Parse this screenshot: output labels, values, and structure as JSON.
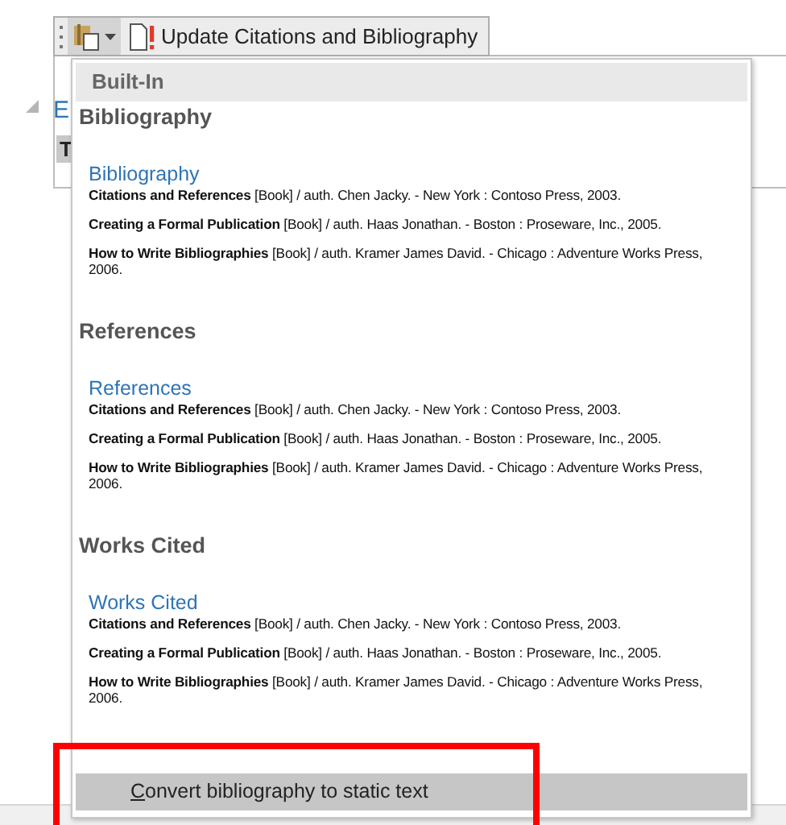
{
  "toolbar": {
    "update_button": "Update Citations and Bibliography"
  },
  "document": {
    "heading_fragment": "E",
    "text_fragment": "T"
  },
  "menu": {
    "header": "Built-In",
    "sections": [
      {
        "heading": "Bibliography",
        "preview_title": "Bibliography",
        "entries": [
          "**Citations and References** [Book] / auth. Chen Jacky. - New York : Contoso Press, 2003.",
          "**Creating a Formal Publication** [Book] / auth. Haas Jonathan. - Boston : Proseware, Inc., 2005.",
          "**How to Write Bibliographies** [Book] / auth. Kramer James David. - Chicago : Adventure Works Press, 2006."
        ]
      },
      {
        "heading": "References",
        "preview_title": "References",
        "entries": [
          "**Citations and References** [Book] / auth. Chen Jacky. - New York : Contoso Press, 2003.",
          "**Creating a Formal Publication** [Book] / auth. Haas Jonathan. - Boston : Proseware, Inc., 2005.",
          "**How to Write Bibliographies** [Book] / auth. Kramer James David. - Chicago : Adventure Works Press, 2006."
        ]
      },
      {
        "heading": "Works Cited",
        "preview_title": "Works Cited",
        "entries": [
          "**Citations and References** [Book] / auth. Chen Jacky. - New York : Contoso Press, 2003.",
          "**Creating a Formal Publication** [Book] / auth. Haas Jonathan. - Boston : Proseware, Inc., 2005.",
          "**How to Write Bibliographies** [Book] / auth. Kramer James David. - Chicago : Adventure Works Press, 2006."
        ]
      }
    ],
    "command": {
      "access_key": "C",
      "rest": "onvert bibliography to static text",
      "highlighted": true
    }
  }
}
